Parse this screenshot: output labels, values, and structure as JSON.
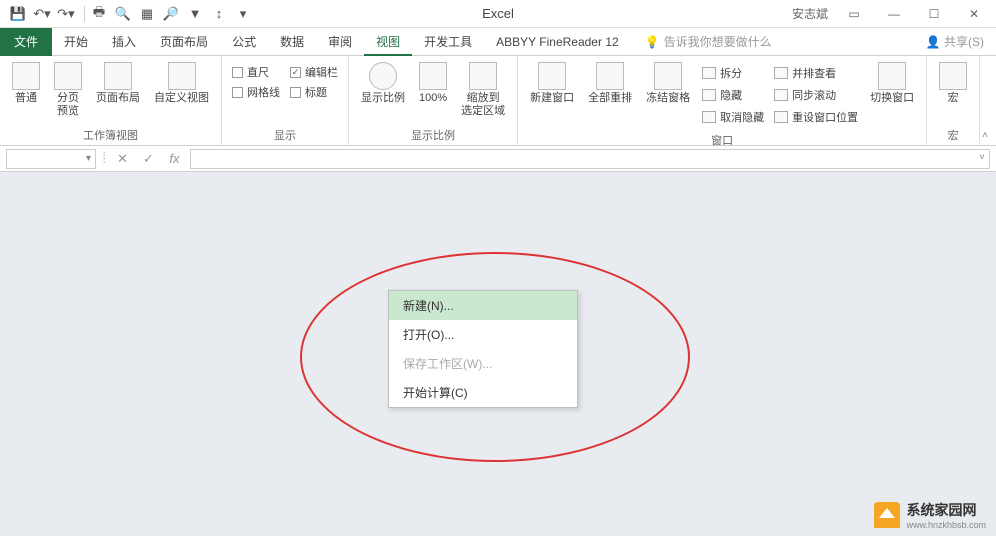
{
  "qat": {
    "title": "Excel",
    "user": "安志斌",
    "icons": [
      "save-icon",
      "undo-icon",
      "redo-icon",
      "sep",
      "print-icon",
      "print-preview-icon",
      "page-setup-icon",
      "find-icon",
      "filter-icon",
      "sort-icon",
      "more-icon"
    ]
  },
  "tabs": {
    "file": "文件",
    "items": [
      "开始",
      "插入",
      "页面布局",
      "公式",
      "数据",
      "审阅",
      "视图",
      "开发工具",
      "ABBYY FineReader 12"
    ],
    "active_index": 6,
    "tellme_placeholder": "告诉我你想要做什么",
    "share": "共享(S)"
  },
  "ribbon": {
    "groups": {
      "workbook_views": {
        "label": "工作簿视图",
        "normal": "普通",
        "page_break": "分页\n预览",
        "page_layout": "页面布局",
        "custom_views": "自定义视图"
      },
      "show": {
        "label": "显示",
        "ruler": "直尺",
        "formula_bar": "编辑栏",
        "gridlines": "网格线",
        "headings": "标题",
        "formula_bar_checked": true
      },
      "zoom": {
        "label": "显示比例",
        "zoom": "显示比例",
        "hundred": "100%",
        "to_selection": "缩放到\n选定区域"
      },
      "window": {
        "label": "窗口",
        "new_window": "新建窗口",
        "arrange_all": "全部重排",
        "freeze": "冻结窗格",
        "split": "拆分",
        "hide": "隐藏",
        "unhide": "取消隐藏",
        "side_by_side": "并排查看",
        "sync_scroll": "同步滚动",
        "reset_pos": "重设窗口位置",
        "switch": "切换窗口"
      },
      "macros": {
        "label": "宏",
        "macros": "宏"
      }
    }
  },
  "formula": {
    "fx": "fx"
  },
  "context_menu": {
    "new": "新建(N)...",
    "open": "打开(O)...",
    "save_workspace": "保存工作区(W)...",
    "calculate": "开始计算(C)"
  },
  "watermark": {
    "title": "系统家园网",
    "sub": "www.hnzkhbsb.com"
  }
}
